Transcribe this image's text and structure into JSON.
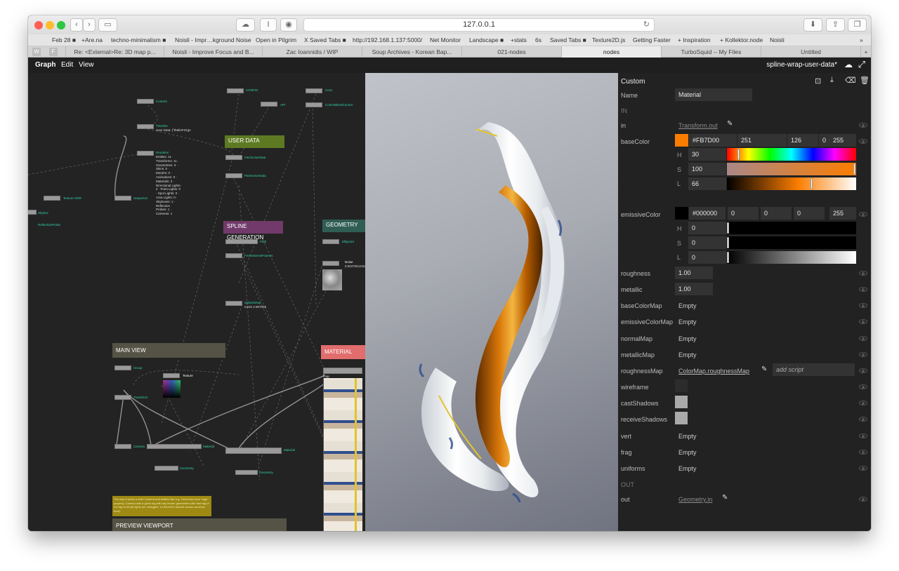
{
  "browser": {
    "url": "127.0.0.1",
    "favorites": [
      "Feb 28 ■",
      "+Are.na",
      "techno-minimalism ■",
      "Noisli - Impr…kground Noise",
      "Open in Pilgrim",
      "X Saved Tabs ■",
      "http://192.168.1.137:5000/",
      "Net Monitor",
      "Landscape ■",
      "+stats",
      "6s",
      "Saved Tabs ■",
      "Texture2D.js",
      "Getting Faster",
      "+ Inspiration",
      "+ Kollektor.node",
      "Noisli"
    ],
    "favorites_more": "»",
    "pinned": [
      "W",
      "F"
    ],
    "tabs": [
      {
        "label": "Re: <External>Re: 3D map p..."
      },
      {
        "label": "Noisli - Improve Focus and B..."
      },
      {
        "label": "Zac Ioannidis / WIP"
      },
      {
        "label": "Soup Archives - Korean Bap..."
      },
      {
        "label": "021-nodes"
      },
      {
        "label": "nodes",
        "active": true
      },
      {
        "label": "TurboSquid -- My Files"
      },
      {
        "label": "Untitled"
      }
    ],
    "new_tab": "+"
  },
  "app": {
    "menu": [
      "Graph",
      "Edit",
      "View"
    ],
    "title": "spline-wrap-user-data*"
  },
  "graph": {
    "nodes": [
      {
        "label": "Content"
      },
      {
        "label": "Timeline",
        "sub": "User Data: {\"tbMinFOrgn"
      },
      {
        "label": "Renderer",
        "sub": "Entities: 11 · Transforms: 11 · Geometries: 3 · Skins: 0 · Morphs: 0 · Animations: 0 · Materials: 3 · Directional Lights: 2 · Point Lights: 0 · Spot Lights: 0 · Area Lights: 0 · Skyboxes: 1 · Reflection Probes: 1 · Cameras: 1"
      },
      {
        "label": "Sequence"
      },
      {
        "label": "Texture HDR"
      },
      {
        "label": "Skybox"
      },
      {
        "label": "ReflectionProbe"
      },
      {
        "label": "CONFIG"
      },
      {
        "label": "API"
      },
      {
        "label": "Conv"
      },
      {
        "label": "ColorsBlendCurve3"
      },
      {
        "label": "FetchUserData"
      },
      {
        "label": "ParseUserData"
      },
      {
        "label": "Path"
      },
      {
        "label": "FrenetSerretFrames"
      },
      {
        "label": "SplineWrap",
        "sub": "mesh 2.967025"
      },
      {
        "label": "Ellipsoid"
      },
      {
        "label": "Noise",
        "sub": "0.0047051216"
      },
      {
        "label": "Group"
      },
      {
        "label": "Texture"
      },
      {
        "label": "Transform"
      },
      {
        "label": "Camera"
      },
      {
        "label": "Material"
      },
      {
        "label": "Geometry"
      },
      {
        "label": "Material"
      },
      {
        "label": "Geometry"
      },
      {
        "label": "map"
      }
    ],
    "groups": {
      "user_data": "USER DATA",
      "spline_generation": "SPLINE GENERATION",
      "geometry": "GEOMETRY",
      "main_view": "MAIN VIEW",
      "material": "MATERIAL",
      "preview_viewport": "PREVIEW VIEWPORT"
    },
    "comment": "The way it works is both Camera and entities like e.g. Geometry have \"tags\" property. Camera with a given tag will only render geometries with that tag or not tag at all (all lights are untagged, so therefore shared across cameras here)."
  },
  "panel": {
    "title": "Custom",
    "toolbar_icons": [
      "fit-icon",
      "download-icon",
      "eraser-icon",
      "trash-icon"
    ],
    "name": {
      "label": "Name",
      "value": "Material"
    },
    "in_section": "IN",
    "in": {
      "label": "in",
      "link": "Transform.out"
    },
    "baseColor": {
      "label": "baseColor",
      "hex": "#FB7D00",
      "r": "251",
      "g": "126",
      "b": "0",
      "a": "255",
      "h": "30",
      "s": "100",
      "l": "66",
      "h_value": 30,
      "s_value": 100,
      "l_value": 66,
      "swatch": "#FB7D00"
    },
    "emissiveColor": {
      "label": "emissiveColor",
      "hex": "#000000",
      "r": "0",
      "g": "0",
      "b": "0",
      "a": "255",
      "h": "0",
      "s": "0",
      "l": "0",
      "swatch": "#000000"
    },
    "hsl_labels": [
      "H",
      "S",
      "L"
    ],
    "roughness": {
      "label": "roughness",
      "value": "1.00"
    },
    "metallic": {
      "label": "metallic",
      "value": "1.00"
    },
    "baseColorMap": {
      "label": "baseColorMap",
      "value": "Empty"
    },
    "emissiveColorMap": {
      "label": "emissiveColorMap",
      "value": "Empty"
    },
    "normalMap": {
      "label": "normalMap",
      "value": "Empty"
    },
    "metallicMap": {
      "label": "metallicMap",
      "value": "Empty"
    },
    "roughnessMap": {
      "label": "roughnessMap",
      "link": "ColorMap.roughnessMap",
      "script_placeholder": "add script"
    },
    "wireframe": {
      "label": "wireframe",
      "checked": false
    },
    "castShadows": {
      "label": "castShadows",
      "checked": true
    },
    "receiveShadows": {
      "label": "receiveShadows",
      "checked": true
    },
    "vert": {
      "label": "vert",
      "value": "Empty"
    },
    "frag": {
      "label": "frag",
      "value": "Empty"
    },
    "uniforms": {
      "label": "uniforms",
      "value": "Empty"
    },
    "out_section": "OUT",
    "out": {
      "label": "out",
      "link": "Geometry.in"
    }
  }
}
